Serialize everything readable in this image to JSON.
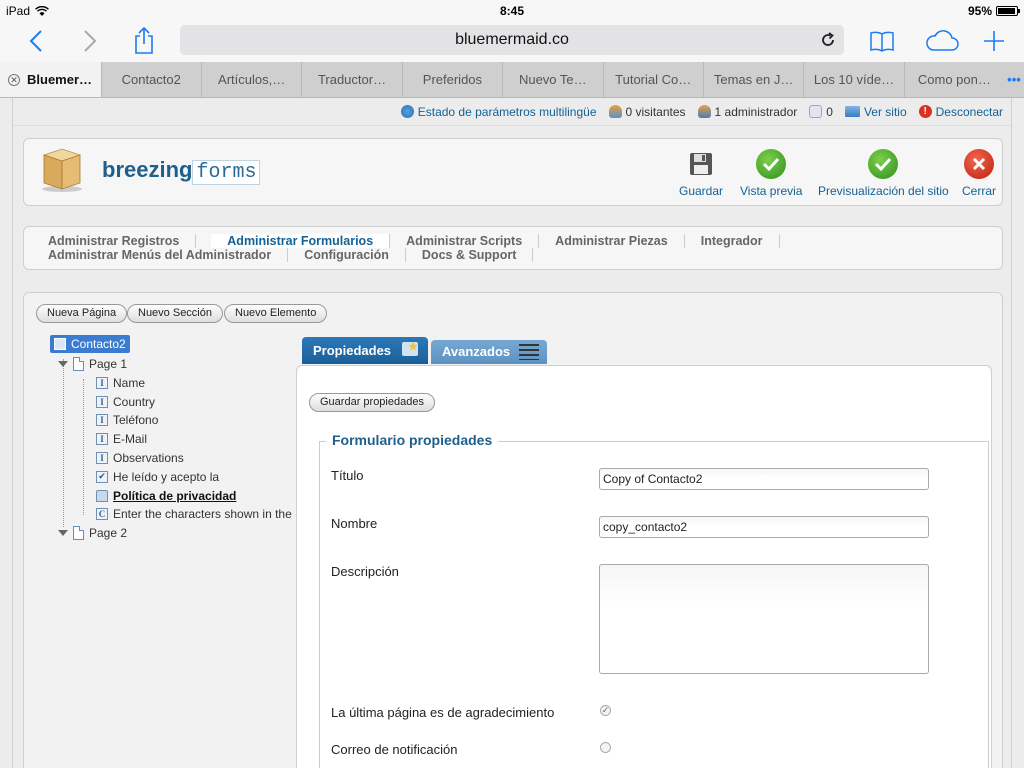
{
  "status_bar": {
    "device": "iPad",
    "time": "8:45",
    "battery": "95%",
    "battery_level": 0.95
  },
  "browser": {
    "url": "bluemermaid.co",
    "tabs": [
      {
        "label": "Bluemer…",
        "active": true
      },
      {
        "label": "Contacto2"
      },
      {
        "label": "Artículos,…"
      },
      {
        "label": "Traductor…"
      },
      {
        "label": "Preferidos"
      },
      {
        "label": "Nuevo Te…"
      },
      {
        "label": "Tutorial Co…"
      },
      {
        "label": "Temas en J…"
      },
      {
        "label": "Los 10 víde…"
      },
      {
        "label": "Como pon…"
      }
    ],
    "more_tabs": "•••"
  },
  "admin_bar": {
    "multilingual": "Estado de parámetros multilingüe",
    "visitors": "0 visitantes",
    "admins": "1 administrador",
    "messages": "0",
    "view_site": "Ver sitio",
    "logout": "Desconectar"
  },
  "header": {
    "logo_main": "breezing",
    "logo_forms": "forms",
    "buttons": {
      "save": "Guardar",
      "preview": "Vista previa",
      "site_preview": "Previsualización del sitio",
      "close": "Cerrar"
    }
  },
  "menu": {
    "row1": [
      "Administrar Registros",
      "Administrar Formularios",
      "Administrar Scripts",
      "Administrar Piezas",
      "Integrador"
    ],
    "row2": [
      "Administrar Menús del Administrador",
      "Configuración",
      "Docs & Support"
    ]
  },
  "toolbar": {
    "new_page": "Nueva Página",
    "new_section": "Nuevo Sección",
    "new_element": "Nuevo Elemento"
  },
  "tree": {
    "root": "Contacto2",
    "page1": "Page 1",
    "items": [
      {
        "label": "Name",
        "icon": "I"
      },
      {
        "label": "Country",
        "icon": "I"
      },
      {
        "label": "Teléfono",
        "icon": "I"
      },
      {
        "label": "E-Mail",
        "icon": "I"
      },
      {
        "label": "Observations",
        "icon": "I"
      },
      {
        "label": "He leído y acepto la",
        "icon": "check"
      },
      {
        "label": "Política de privacidad",
        "icon": "folder"
      },
      {
        "label": "Enter the characters shown in the",
        "icon": "C"
      }
    ],
    "page2": "Page 2"
  },
  "panel": {
    "tab_properties": "Propiedades",
    "tab_advanced": "Avanzados",
    "save_props": "Guardar propiedades",
    "legend": "Formulario propiedades",
    "title_label": "Título",
    "title_value": "Copy of Contacto2",
    "name_label": "Nombre",
    "name_value": "copy_contacto2",
    "desc_label": "Descripción",
    "desc_value": "",
    "last_page_label": "La última página es de agradecimiento",
    "last_page_checked": true,
    "notify_label": "Correo de notificación",
    "notify_checked": false
  },
  "colors": {
    "accent": "#146295",
    "tab_active": "#1f66a5",
    "tab_inactive": "#5f95c4",
    "ios_blue": "#1a7cf5"
  }
}
